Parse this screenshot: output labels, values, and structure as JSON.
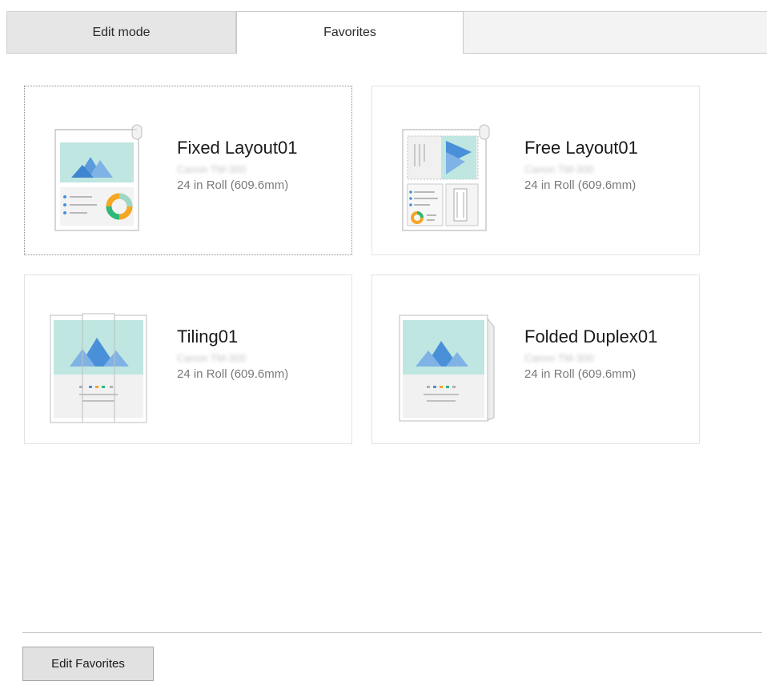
{
  "tabs": {
    "edit_mode": "Edit mode",
    "favorites": "Favorites",
    "active": "Favorites"
  },
  "favorites": [
    {
      "title": "Fixed Layout01",
      "printer": "Canon TM-300",
      "media": "24 in Roll (609.6mm)",
      "icon": "fixed-layout-icon",
      "selected": true
    },
    {
      "title": "Free Layout01",
      "printer": "Canon TM-300",
      "media": "24 in Roll (609.6mm)",
      "icon": "free-layout-icon",
      "selected": false
    },
    {
      "title": "Tiling01",
      "printer": "Canon TM-300",
      "media": "24 in Roll (609.6mm)",
      "icon": "tiling-icon",
      "selected": false
    },
    {
      "title": "Folded Duplex01",
      "printer": "Canon TM-300",
      "media": "24 in Roll (609.6mm)",
      "icon": "folded-duplex-icon",
      "selected": false
    }
  ],
  "footer": {
    "edit_favorites_label": "Edit Favorites"
  },
  "colors": {
    "accent_teal": "#bfe6e0",
    "accent_blue": "#4a90d9",
    "accent_orange": "#f5a623",
    "accent_green": "#2fb87a"
  }
}
